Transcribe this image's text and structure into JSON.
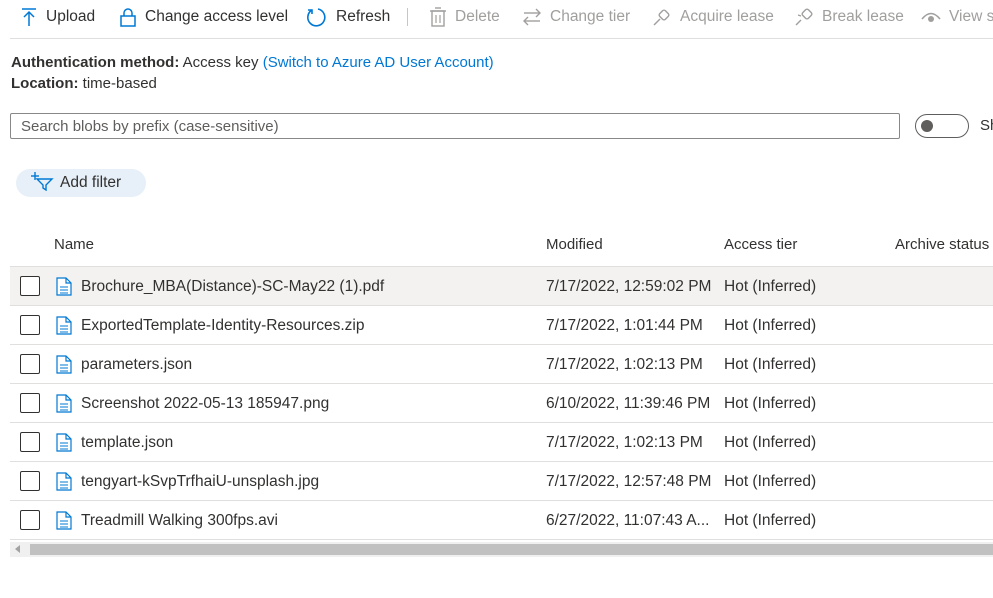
{
  "toolbar": {
    "upload": "Upload",
    "change_access": "Change access level",
    "refresh": "Refresh",
    "delete": "Delete",
    "change_tier": "Change tier",
    "acquire_lease": "Acquire lease",
    "break_lease": "Break lease",
    "view_snapshots": "View s"
  },
  "info": {
    "auth_label": "Authentication method:",
    "auth_value": "Access key",
    "auth_link": "(Switch to Azure AD User Account)",
    "location_label": "Location:",
    "location_value": "time-based"
  },
  "search": {
    "placeholder": "Search blobs by prefix (case-sensitive)",
    "toggle_label": "Sh"
  },
  "filter": {
    "label": "Add filter"
  },
  "table": {
    "headers": {
      "name": "Name",
      "modified": "Modified",
      "access_tier": "Access tier",
      "archive_status": "Archive status"
    },
    "rows": [
      {
        "name": "Brochure_MBA(Distance)-SC-May22 (1).pdf",
        "modified": "7/17/2022, 12:59:02 PM",
        "tier": "Hot (Inferred)"
      },
      {
        "name": "ExportedTemplate-Identity-Resources.zip",
        "modified": "7/17/2022, 1:01:44 PM",
        "tier": "Hot (Inferred)"
      },
      {
        "name": "parameters.json",
        "modified": "7/17/2022, 1:02:13 PM",
        "tier": "Hot (Inferred)"
      },
      {
        "name": "Screenshot 2022-05-13 185947.png",
        "modified": "6/10/2022, 11:39:46 PM",
        "tier": "Hot (Inferred)"
      },
      {
        "name": "template.json",
        "modified": "7/17/2022, 1:02:13 PM",
        "tier": "Hot (Inferred)"
      },
      {
        "name": "tengyart-kSvpTrfhaiU-unsplash.jpg",
        "modified": "7/17/2022, 12:57:48 PM",
        "tier": "Hot (Inferred)"
      },
      {
        "name": "Treadmill Walking 300fps.avi",
        "modified": "6/27/2022, 11:07:43 A...",
        "tier": "Hot (Inferred)"
      }
    ]
  },
  "colors": {
    "accent": "#0078d4",
    "pill_bg": "#e7f0f8",
    "row_hover": "#f3f2f1",
    "disabled": "#a19f9d"
  }
}
